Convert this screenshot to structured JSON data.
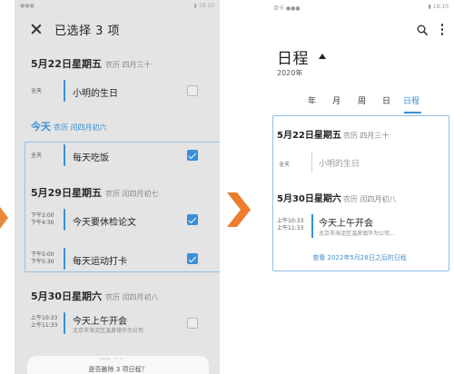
{
  "left": {
    "status_left": "●●● ",
    "status_right": "▮ 18:10",
    "header_title": "已选择 3 项",
    "days": [
      {
        "date": "5月22日星期五",
        "lunar": "农历 四月三十"
      },
      {
        "date": "今天",
        "lunar": "农历 闰四月初六"
      },
      {
        "date": "5月29日星期五",
        "lunar": "农历 闰四月初七"
      },
      {
        "date": "5月30日星期六",
        "lunar": "农历 闰四月初八"
      }
    ],
    "events": [
      {
        "time1": "全天",
        "time2": "",
        "title": "小明的生日",
        "address": "",
        "checked": false
      },
      {
        "time1": "全天",
        "time2": "",
        "title": "每天吃饭",
        "address": "",
        "checked": true
      },
      {
        "time1": "下午2:00",
        "time2": "下午4:30",
        "title": "今天要休检论文",
        "address": "",
        "checked": true
      },
      {
        "time1": "下午5:00",
        "time2": "下午5:30",
        "title": "每天运动打卡",
        "address": "",
        "checked": true
      },
      {
        "time1": "上午10:33",
        "time2": "上午11:33",
        "title": "今天上午开会",
        "address": "北京市海淀区温泉镇华为公司",
        "checked": false
      }
    ],
    "bottom_action": "是否删除 3 项日程？"
  },
  "right": {
    "status_left": "单卡 ●●● ",
    "status_right": "▮ 18:10",
    "title": "日程",
    "year": "2020年",
    "tabs": [
      "年",
      "月",
      "周",
      "日",
      "日程"
    ],
    "active_tab": 4,
    "days": [
      {
        "date": "5月22日星期五",
        "lunar": "农历 四月三十"
      },
      {
        "date": "5月30日星期六",
        "lunar": "农历 闰四月初八"
      }
    ],
    "events": [
      {
        "time1": "全天",
        "time2": "",
        "title": "小明的生日",
        "address": ""
      },
      {
        "time1": "上午10:33",
        "time2": "上午11:33",
        "title": "今天上午开会",
        "address": "北京市海淀区温泉镇华为公司..."
      }
    ],
    "link": "查看 2022年5月28日之后的日程"
  },
  "watermark": "ʷʷʷ.ʳʳ.ʳʳ"
}
